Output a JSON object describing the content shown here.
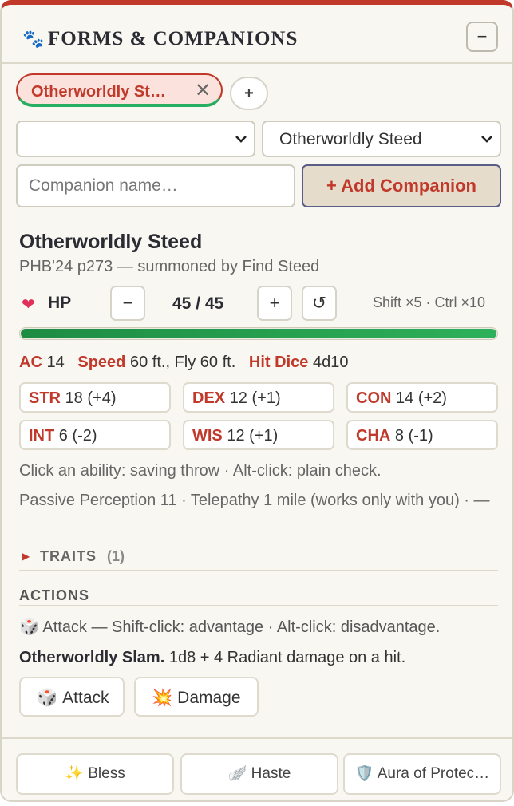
{
  "panel": {
    "title": "FORMS & COMPANIONS",
    "collapse_label": "−"
  },
  "tabs": {
    "active_label": "Otherworldly St…",
    "close_label": "✕",
    "add_label": "+"
  },
  "selects": {
    "form_value": "",
    "companion_value": "Otherworldly Steed"
  },
  "add_companion": {
    "placeholder": "Companion name…",
    "button_label": "+ Add Companion"
  },
  "companion": {
    "name": "Otherworldly Steed",
    "source": "PHB'24 p273 — summoned by Find Steed",
    "hp": {
      "label": "HP",
      "value": "45 / 45",
      "fraction": 1.0,
      "minus": "−",
      "plus": "+",
      "reset": "↺",
      "hint": "Shift ×5 · Ctrl ×10"
    },
    "stats": {
      "ac_label": "AC",
      "ac": "14",
      "speed_label": "Speed",
      "speed": "60 ft., Fly 60 ft.",
      "hd_label": "Hit Dice",
      "hd": "4d10"
    },
    "abilities": [
      {
        "key": "STR",
        "value": "18 (+4)"
      },
      {
        "key": "DEX",
        "value": "12 (+1)"
      },
      {
        "key": "CON",
        "value": "14 (+2)"
      },
      {
        "key": "INT",
        "value": "6 (-2)"
      },
      {
        "key": "WIS",
        "value": "12 (+1)"
      },
      {
        "key": "CHA",
        "value": "8 (-1)"
      }
    ],
    "ability_hint": "Click an ability: saving throw · Alt-click: plain check.",
    "passive": "Passive Perception 11 · Telepathy 1 mile (works only with you) · —",
    "traits": {
      "label": "TRAITS",
      "count": "(1)"
    },
    "actions": {
      "heading": "ACTIONS",
      "hint": "Attack — Shift-click: advantage · Alt-click: disadvantage.",
      "name": "Otherworldly Slam.",
      "desc": "1d8 + 4 Radiant damage on a hit.",
      "attack_label": "Attack",
      "damage_label": "Damage"
    }
  },
  "spells": [
    {
      "icon": "✨",
      "label": "Bless"
    },
    {
      "icon": "🪽",
      "label": "Haste"
    },
    {
      "icon": "🛡️",
      "label": "Aura of Protec…"
    }
  ]
}
